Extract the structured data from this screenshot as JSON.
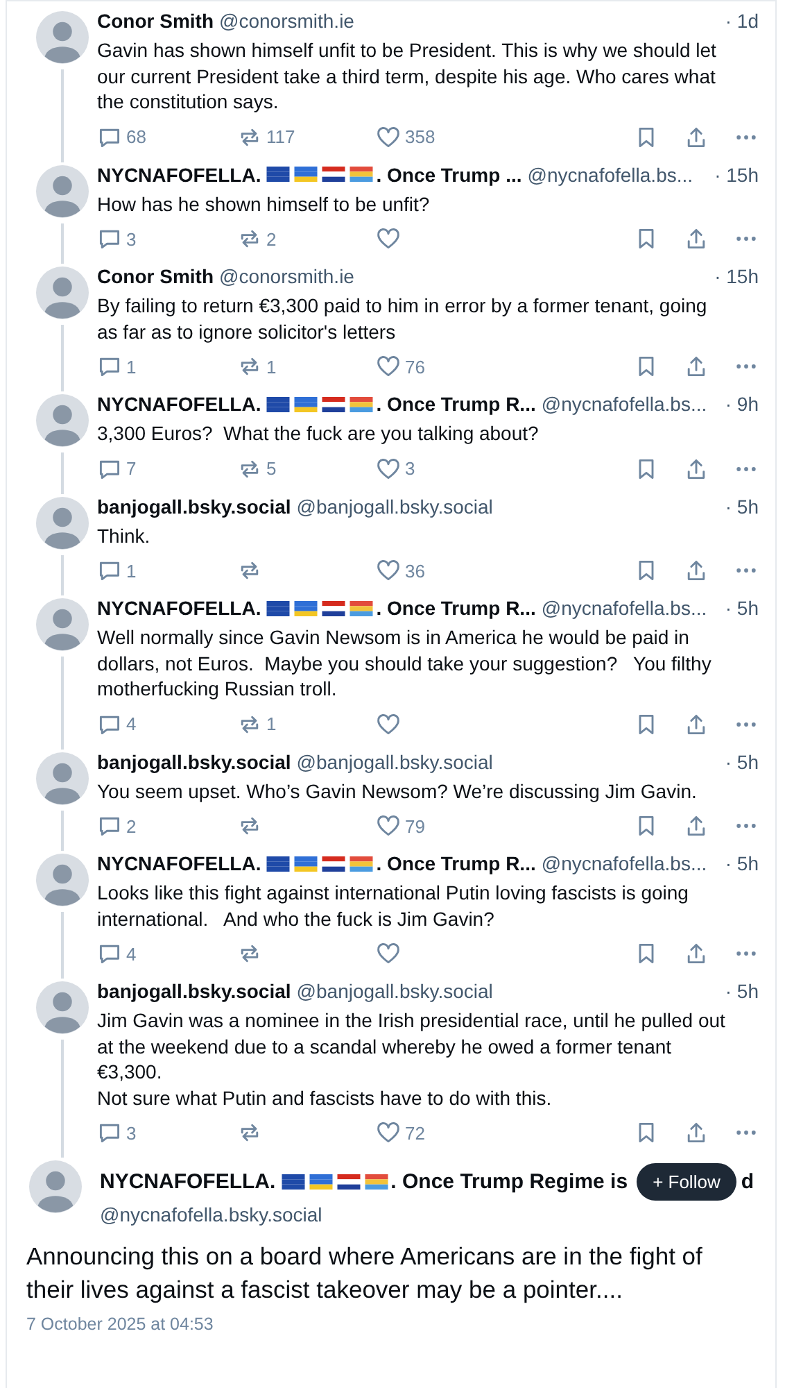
{
  "replies": [
    {
      "name_parts": [
        "Conor Smith"
      ],
      "handle": "@conorsmith.ie",
      "time": "· 1d",
      "text": "Gavin has shown himself unfit to be President. This is why we should let our current President take a third term, despite his age. Who cares what the constitution says.",
      "replies": "68",
      "reposts": "117",
      "likes": "358"
    },
    {
      "name_parts": [
        "NYCNAFOFELLA.",
        ". Once Trump ..."
      ],
      "handle": "@nycnafofella.bs...",
      "time": "· 15h",
      "text": "How has he shown himself to be unfit?",
      "replies": "3",
      "reposts": "2"
    },
    {
      "name_parts": [
        "Conor Smith"
      ],
      "handle": "@conorsmith.ie",
      "time": "· 15h",
      "text": "By failing to return €3,300 paid to him in error by a former tenant, going as far as to ignore solicitor's letters",
      "replies": "1",
      "reposts": "1",
      "likes": "76"
    },
    {
      "name_parts": [
        "NYCNAFOFELLA.",
        ". Once Trump R..."
      ],
      "handle": "@nycnafofella.bs...",
      "time": "· 9h",
      "text": "3,300 Euros?  What the fuck are you talking about?",
      "replies": "7",
      "reposts": "5",
      "likes": "3"
    },
    {
      "name_parts": [
        "banjogall.bsky.social"
      ],
      "handle": "@banjogall.bsky.social",
      "time": "· 5h",
      "text": "Think.",
      "replies": "1",
      "likes": "36"
    },
    {
      "name_parts": [
        "NYCNAFOFELLA.",
        ". Once Trump R..."
      ],
      "handle": "@nycnafofella.bs...",
      "time": "· 5h",
      "text": "Well normally since Gavin Newsom is in America he would be paid in dollars, not Euros.  Maybe you should take your suggestion?   You filthy motherfucking Russian troll.",
      "replies": "4",
      "reposts": "1"
    },
    {
      "name_parts": [
        "banjogall.bsky.social"
      ],
      "handle": "@banjogall.bsky.social",
      "time": "· 5h",
      "text": "You seem upset. Who’s Gavin Newsom? We’re discussing Jim Gavin.",
      "replies": "2",
      "likes": "79"
    },
    {
      "name_parts": [
        "NYCNAFOFELLA.",
        ". Once Trump R..."
      ],
      "handle": "@nycnafofella.bs...",
      "time": "· 5h",
      "text": "Looks like this fight against international Putin loving fascists is going international.   And who the fuck is Jim Gavin?",
      "replies": "4"
    },
    {
      "name_parts": [
        "banjogall.bsky.social"
      ],
      "handle": "@banjogall.bsky.social",
      "time": "· 5h",
      "text": "Jim Gavin was a nominee in the Irish presidential race, until he pulled out at the weekend due to a scandal whereby he owed a former tenant €3,300.\nNot sure what Putin and fascists have to do with this.",
      "replies": "3",
      "likes": "72"
    }
  ],
  "main_post": {
    "name_parts": [
      "NYCNAFOFELLA.",
      ". Once Trump Regime is"
    ],
    "name_tail": "d",
    "handle": "@nycnafofella.bsky.social",
    "follow_button": "+ Follow",
    "text": "Announcing this on a board where Americans are in the fight of their lives against a fascist takeover may be a pointer....",
    "date": "7 October 2025 at 04:53"
  }
}
